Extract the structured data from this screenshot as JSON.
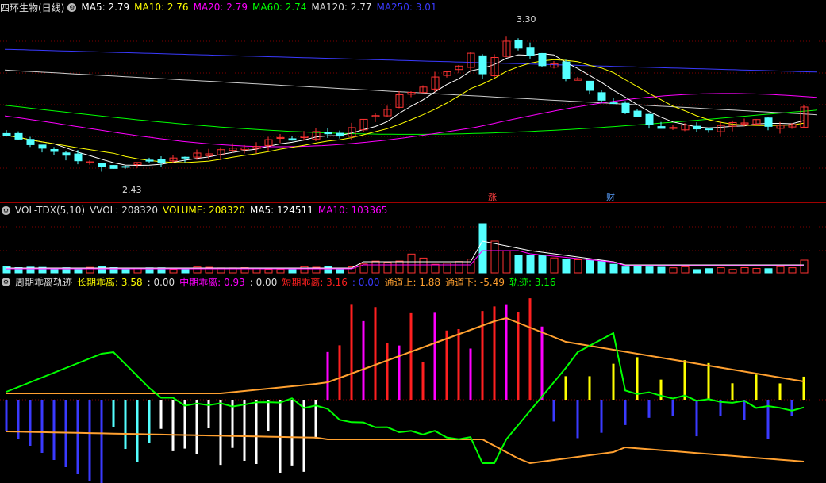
{
  "main": {
    "title": "四环生物(日线)",
    "indicators": [
      {
        "label": "MA5: 2.79",
        "color": "#ffffff"
      },
      {
        "label": "MA10: 2.76",
        "color": "#ffff00"
      },
      {
        "label": "MA20: 2.79",
        "color": "#ff00ff"
      },
      {
        "label": "MA60: 2.74",
        "color": "#00ff00"
      },
      {
        "label": "MA120: 2.77",
        "color": "#dddddd"
      },
      {
        "label": "MA250: 3.01",
        "color": "#3a3aff"
      }
    ],
    "high_label": "3.30",
    "low_label": "2.43",
    "events": [
      {
        "label": "涨"
      },
      {
        "label": "财"
      }
    ]
  },
  "volume": {
    "title": "VOL-TDX(5,10)",
    "indicators": [
      {
        "label": "VVOL: 208320",
        "color": "#dddddd"
      },
      {
        "label": "VOLUME: 208320",
        "color": "#ffff00"
      },
      {
        "label": "MA5: 124511",
        "color": "#ffffff"
      },
      {
        "label": "MA10: 103365",
        "color": "#ff00ff"
      }
    ]
  },
  "cycle": {
    "title": "周期乖离轨迹",
    "indicators": [
      {
        "label": "长期乖离: 3.58",
        "color": "#ffff00"
      },
      {
        "label": ": 0.00",
        "color": "#dddddd"
      },
      {
        "label": "中期乖离: 0.93",
        "color": "#ff00ff"
      },
      {
        "label": ": 0.00",
        "color": "#dddddd"
      },
      {
        "label": "短期乖离: 3.16",
        "color": "#ff2020"
      },
      {
        "label": ": 0.00",
        "color": "#3a3aff"
      },
      {
        "label": "通道上: 1.88",
        "color": "#ffa030"
      },
      {
        "label": "通道下: -5.49",
        "color": "#ffa030"
      },
      {
        "label": "轨迹: 3.16",
        "color": "#00ff00"
      }
    ]
  },
  "colors": {
    "up": "#ff3232",
    "down": "#54ffff",
    "grid": "#800000"
  }
}
